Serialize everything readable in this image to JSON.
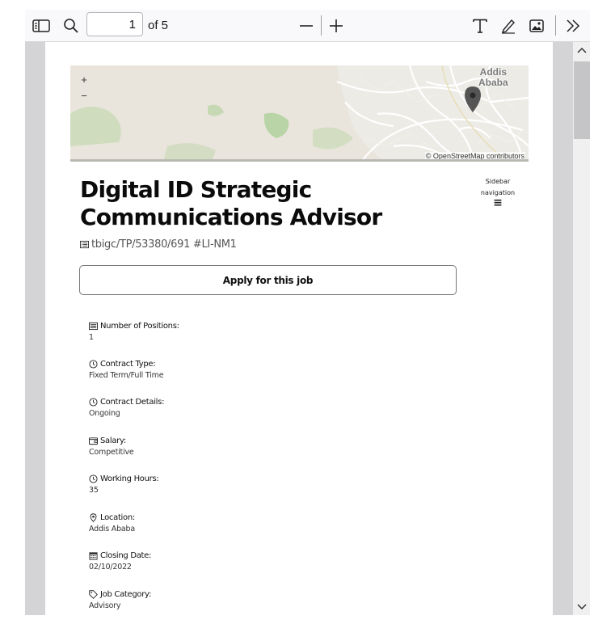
{
  "toolbar": {
    "page_number": "1",
    "page_of": "of 5"
  },
  "map": {
    "zoom_in": "+",
    "zoom_out": "−",
    "city_label_line1": "Addis",
    "city_label_line2": "Ababa",
    "attribution": "© OpenStreetMap contributors"
  },
  "job": {
    "title": "Digital ID Strategic Communications Advisor",
    "reference": "tbigc/TP/53380/691 #LI-NM1",
    "apply_label": "Apply for this job",
    "sidebar_nav_line1": "Sidebar",
    "sidebar_nav_line2": "navigation",
    "sidebar_nav_icon": "≡"
  },
  "details": [
    {
      "icon": "list-icon",
      "label": "Number of Positions:",
      "value": "1"
    },
    {
      "icon": "clock-icon",
      "label": "Contract Type:",
      "value": "Fixed Term/Full Time"
    },
    {
      "icon": "clock-icon",
      "label": "Contract Details:",
      "value": "Ongoing"
    },
    {
      "icon": "wallet-icon",
      "label": "Salary:",
      "value": "Competitive"
    },
    {
      "icon": "clock-icon",
      "label": "Working Hours:",
      "value": "35"
    },
    {
      "icon": "map-pin-icon",
      "label": "Location:",
      "value": "Addis Ababa"
    },
    {
      "icon": "calendar-icon",
      "label": "Closing Date:",
      "value": "02/10/2022"
    },
    {
      "icon": "tag-icon",
      "label": "Job Category:",
      "value": "Advisory"
    }
  ]
}
